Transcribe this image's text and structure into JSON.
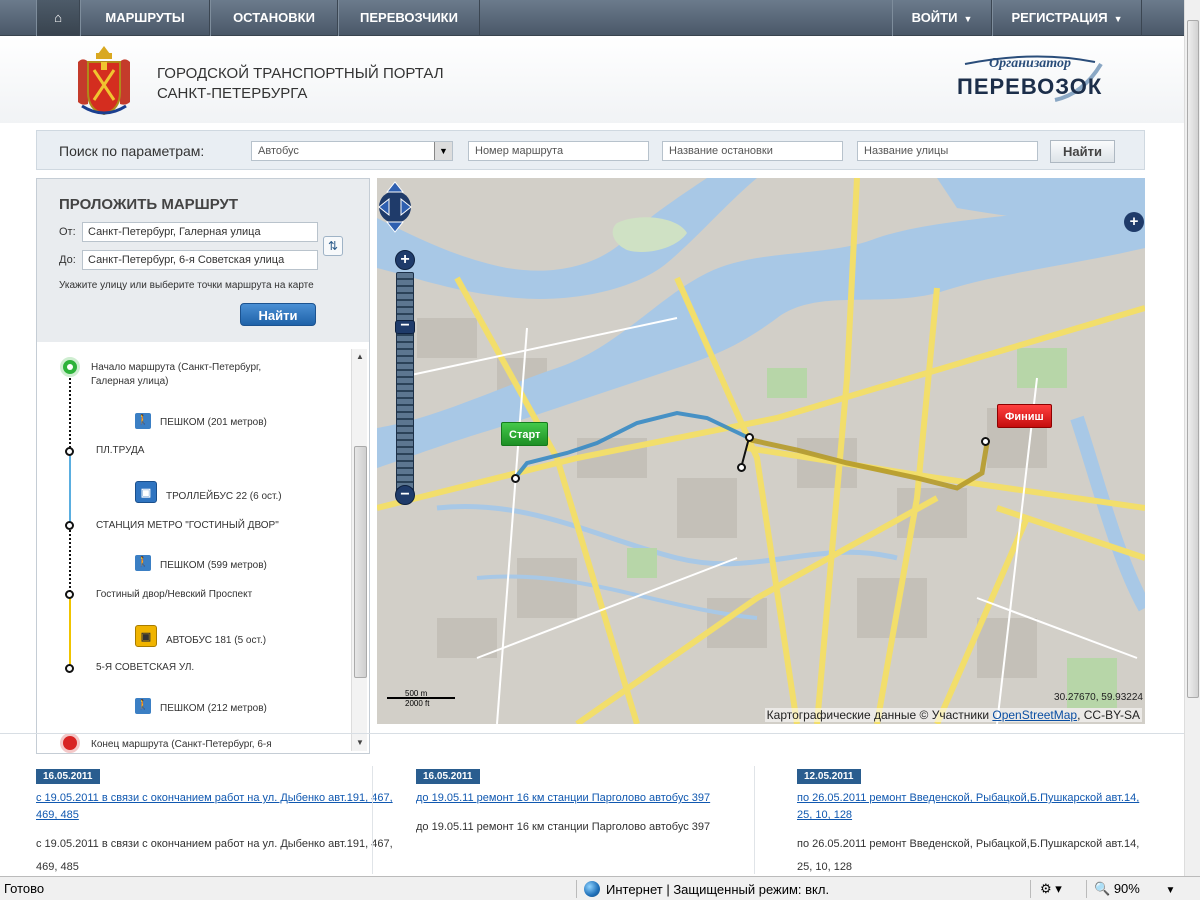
{
  "nav": {
    "home_icon": "home-icon",
    "items": [
      "МАРШРУТЫ",
      "ОСТАНОВКИ",
      "ПЕРЕВОЗЧИКИ"
    ],
    "login": "ВОЙТИ",
    "register": "РЕГИСТРАЦИЯ"
  },
  "header": {
    "title_line1": "ГОРОДСКОЙ ТРАНСПОРТНЫЙ ПОРТАЛ",
    "title_line2": "САНКТ-ПЕТЕРБУРГА",
    "logo_top": "Организатор",
    "logo_bottom": "ПЕРЕВОЗОК"
  },
  "search": {
    "label": "Поиск по параметрам:",
    "transport_type": "Автобус",
    "route_placeholder": "Номер маршрута",
    "stop_placeholder": "Название остановки",
    "street_placeholder": "Название улицы",
    "button": "Найти"
  },
  "route": {
    "title": "ПРОЛОЖИТЬ МАРШРУТ",
    "from_label": "От:",
    "from_value": "Санкт-Петербург, Галерная улица",
    "to_label": "До:",
    "to_value": "Санкт-Петербург, 6-я Советская улица",
    "hint": "Укажите улицу или выберите точки маршрута на карте",
    "button": "Найти",
    "steps": {
      "start": "Начало маршрута (Санкт-Петербург, Галерная улица)",
      "walk1": "ПЕШКОМ (201 метров)",
      "stop1": "ПЛ.ТРУДА",
      "trolley": "ТРОЛЛЕЙБУС 22 (6 ост.)",
      "stop2": "СТАНЦИЯ МЕТРО \"ГОСТИНЫЙ ДВОР\"",
      "walk2": "ПЕШКОМ (599 метров)",
      "stop3": "Гостиный двор/Невский Проспект",
      "bus": "АВТОБУС 181 (5 ост.)",
      "stop4": "5-Я СОВЕТСКАЯ УЛ.",
      "walk3": "ПЕШКОМ (212 метров)",
      "end": "Конец маршрута (Санкт-Петербург, 6-я"
    }
  },
  "map": {
    "start_flag": "Старт",
    "finish_flag": "Финиш",
    "coords": "30.27670, 59.93224",
    "attribution_prefix": "Картографические данные © Участники",
    "attribution_link": "OpenStreetMap",
    "attribution_suffix": ", CC-BY-SA",
    "scale_top": "500 m",
    "scale_bottom": "2000 ft"
  },
  "news": [
    {
      "date": "16.05.2011",
      "link": "с 19.05.2011 в связи с окончанием работ на ул. Дыбенко авт.191, 467, 469, 485",
      "body": "с 19.05.2011 в связи с окончанием работ на ул. Дыбенко авт.191, 467, 469, 485"
    },
    {
      "date": "16.05.2011",
      "link": "до 19.05.11 ремонт 16 км станции Парголово автобус 397",
      "body": "до 19.05.11 ремонт 16 км станции Парголово автобус 397"
    },
    {
      "date": "12.05.2011",
      "link": "по 26.05.2011 ремонт Введенской, Рыбацкой,Б.Пушкарской авт.14, 25, 10, 128",
      "body": "по 26.05.2011 ремонт Введенской, Рыбацкой,Б.Пушкарской авт.14, 25, 10, 128"
    }
  ],
  "statusbar": {
    "ready": "Готово",
    "zone": "Интернет | Защищенный режим: вкл.",
    "zoom": "90%"
  },
  "colors": {
    "nav_bg": "#5a6878",
    "water": "#a8c8e6",
    "road": "#f2de6b",
    "route_blue": "#2f86c4",
    "route_gold": "#b59a2a",
    "news_date_bg": "#2a5d8f"
  }
}
